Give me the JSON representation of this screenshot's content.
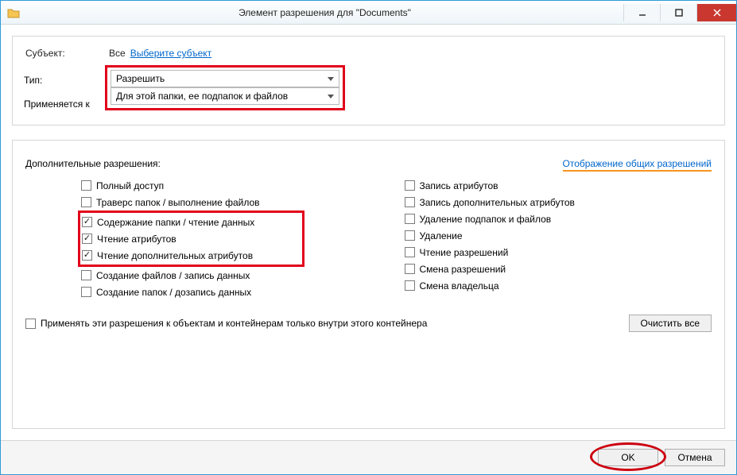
{
  "window": {
    "title": "Элемент разрешения для \"Documents\""
  },
  "subject": {
    "label": "Субъект:",
    "value": "Все",
    "select_link": "Выберите субъект"
  },
  "type": {
    "label": "Тип:",
    "value": "Разрешить"
  },
  "applies": {
    "label": "Применяется к",
    "value": "Для этой папки, ее подпапок и файлов"
  },
  "advanced": {
    "heading": "Дополнительные разрешения:",
    "show_basic_link": "Отображение общих разрешений"
  },
  "perms_left": [
    {
      "label": "Полный доступ",
      "checked": false
    },
    {
      "label": "Траверс папок / выполнение файлов",
      "checked": false
    },
    {
      "label": "Содержание папки / чтение данных",
      "checked": true
    },
    {
      "label": "Чтение атрибутов",
      "checked": true
    },
    {
      "label": "Чтение дополнительных атрибутов",
      "checked": true
    },
    {
      "label": "Создание файлов / запись данных",
      "checked": false
    },
    {
      "label": "Создание папок / дозапись данных",
      "checked": false
    }
  ],
  "perms_right": [
    {
      "label": "Запись атрибутов",
      "checked": false
    },
    {
      "label": "Запись дополнительных атрибутов",
      "checked": false
    },
    {
      "label": "Удаление подпапок и файлов",
      "checked": false
    },
    {
      "label": "Удаление",
      "checked": false
    },
    {
      "label": "Чтение разрешений",
      "checked": false
    },
    {
      "label": "Смена разрешений",
      "checked": false
    },
    {
      "label": "Смена владельца",
      "checked": false
    }
  ],
  "only_container": {
    "label": "Применять эти разрешения к объектам и контейнерам только внутри этого контейнера",
    "checked": false
  },
  "buttons": {
    "clear_all": "Очистить все",
    "ok": "OK",
    "cancel": "Отмена"
  }
}
